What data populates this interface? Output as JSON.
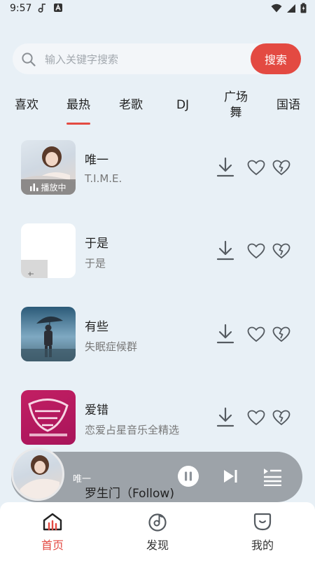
{
  "status_bar": {
    "time": "9:57"
  },
  "search": {
    "placeholder": "输入关键字搜索",
    "value": "",
    "button_label": "搜索"
  },
  "tabs": [
    {
      "label": "喜欢"
    },
    {
      "label": "最热",
      "selected": true
    },
    {
      "label": "老歌"
    },
    {
      "label": "DJ"
    },
    {
      "label": "广场舞"
    },
    {
      "label": "国语"
    }
  ],
  "songs": [
    {
      "title": "唯一",
      "artist": "T.I.M.E.",
      "badge": "播放中"
    },
    {
      "title": "于是",
      "artist": "于是"
    },
    {
      "title": "有些",
      "artist": "失眠症候群"
    },
    {
      "title": "爱错",
      "artist": "恋爱占星音乐全精选"
    }
  ],
  "peek_song": {
    "title": "罗生门（Follow)"
  },
  "mini_player": {
    "title": "唯一"
  },
  "bottom_nav": [
    {
      "label": "首页",
      "icon": "home-icon",
      "active": true
    },
    {
      "label": "发现",
      "icon": "discover-icon"
    },
    {
      "label": "我的",
      "icon": "profile-icon"
    }
  ],
  "colors": {
    "accent": "#e34a42",
    "background": "#e8f0f6",
    "icon_gray": "#555b61"
  }
}
